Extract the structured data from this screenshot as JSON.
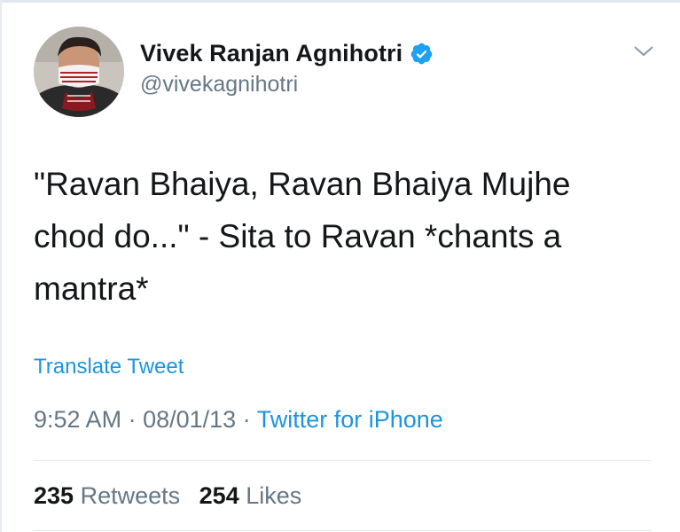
{
  "tweet": {
    "display_name": "Vivek Ranjan Agnihotri",
    "handle": "@vivekagnihotri",
    "text": "\"Ravan Bhaiya, Ravan Bhaiya Mujhe chod do...\" - Sita to Ravan *chants a mantra*",
    "translate_label": "Translate Tweet",
    "time": "9:52 AM",
    "separator": " · ",
    "date": "08/01/13",
    "source": "Twitter for iPhone",
    "retweets_count": "235",
    "retweets_label": "Retweets",
    "likes_count": "254",
    "likes_label": "Likes"
  },
  "icons": {
    "verified": "verified-badge-icon",
    "caret": "chevron-down-icon"
  },
  "colors": {
    "text_primary": "#14171a",
    "text_secondary": "#657786",
    "link": "#1b95e0",
    "verified": "#1da1f2",
    "divider": "#e1e8ed"
  }
}
